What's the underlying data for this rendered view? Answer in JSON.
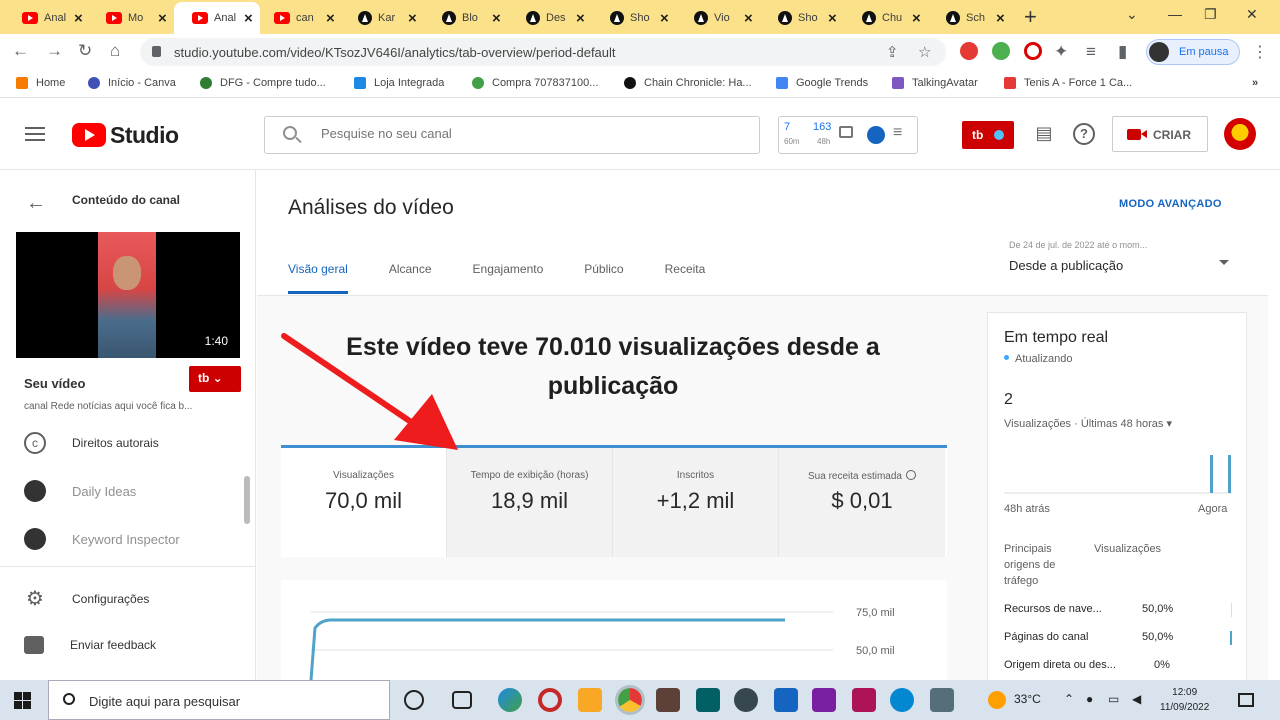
{
  "browser": {
    "tabs": [
      {
        "title": "Anal",
        "icon": "youtube-icon"
      },
      {
        "title": "Mo",
        "icon": "youtube-icon"
      },
      {
        "title": "Anal",
        "icon": "youtube-icon",
        "active": true
      },
      {
        "title": "can",
        "icon": "youtube-icon"
      },
      {
        "title": "Kar",
        "icon": "openai-icon"
      },
      {
        "title": "Blo",
        "icon": "openai-icon"
      },
      {
        "title": "Des",
        "icon": "openai-icon"
      },
      {
        "title": "Sho",
        "icon": "openai-icon"
      },
      {
        "title": "Vio",
        "icon": "openai-icon"
      },
      {
        "title": "Sho",
        "icon": "openai-icon"
      },
      {
        "title": "Chu",
        "icon": "openai-icon"
      },
      {
        "title": "Sch",
        "icon": "openai-icon"
      }
    ],
    "url": "studio.youtube.com/video/KTsozJV646I/analytics/tab-overview/period-default",
    "profile_status": "Em pausa",
    "bookmarks": [
      "Home",
      "Início - Canva",
      "DFG - Compre tudo...",
      "Loja Integrada",
      "Compra 707837100...",
      "Chain Chronicle: Ha...",
      "Google Trends",
      "TalkingAvatar",
      "Tenis A - Force 1 Ca..."
    ]
  },
  "studio": {
    "logo_text": "Studio",
    "search_placeholder": "Pesquise no seu canal",
    "widget": {
      "n1": "7",
      "s1": "60m",
      "n2": "163",
      "s2": "48h"
    },
    "create_label": "CRIAR"
  },
  "sidebar": {
    "title": "Conteúdo do canal",
    "video_duration": "1:40",
    "your_video": "Seu vídeo",
    "channel_desc": "canal Rede notícias aqui você fica b...",
    "items": [
      "Direitos autorais",
      "Daily Ideas",
      "Keyword Inspector",
      "Configurações",
      "Enviar feedback"
    ]
  },
  "main": {
    "title": "Análises do vídeo",
    "advanced_mode": "MODO AVANÇADO",
    "tabs": [
      "Visão geral",
      "Alcance",
      "Engajamento",
      "Público",
      "Receita"
    ],
    "period_range": "De 24 de jul. de 2022 até o mom...",
    "period_label": "Desde a publicação",
    "headline": "Este vídeo teve 70.010 visualizações desde a publicação",
    "metrics": [
      {
        "label": "Visualizações",
        "value": "70,0 mil"
      },
      {
        "label": "Tempo de exibição (horas)",
        "value": "18,9 mil"
      },
      {
        "label": "Inscritos",
        "value": "+1,2 mil"
      },
      {
        "label": "Sua receita estimada",
        "value": "$ 0,01"
      }
    ],
    "chart_ticks": [
      "75,0 mil",
      "50,0 mil"
    ]
  },
  "realtime": {
    "title": "Em tempo real",
    "status": "Atualizando",
    "count": "2",
    "views_label": "Visualizações · Últimas 48 horas",
    "axis_left": "48h atrás",
    "axis_right": "Agora",
    "sources_header": "Principais origens de tráfego",
    "views_header": "Visualizações",
    "sources": [
      {
        "name": "Recursos de nave...",
        "pct": "50,0%"
      },
      {
        "name": "Páginas do canal",
        "pct": "50,0%"
      },
      {
        "name": "Origem direta ou des...",
        "pct": "0%"
      }
    ]
  },
  "taskbar": {
    "search_text": "Digite aqui para pesquisar",
    "temperature": "33°C",
    "time": "12:09",
    "date": "11/09/2022"
  }
}
